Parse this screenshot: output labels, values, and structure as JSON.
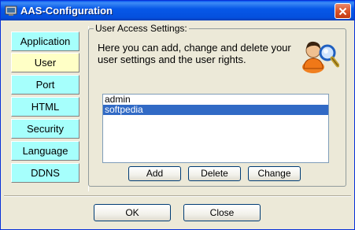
{
  "window": {
    "title": "AAS-Configuration"
  },
  "nav": {
    "items": [
      {
        "label": "Application"
      },
      {
        "label": "User"
      },
      {
        "label": "Port"
      },
      {
        "label": "HTML"
      },
      {
        "label": "Security"
      },
      {
        "label": "Language"
      },
      {
        "label": "DDNS"
      }
    ],
    "active": "User"
  },
  "user_settings": {
    "legend": "User Access Settings:",
    "description": "Here you can add, change and delete your user settings and the user rights.",
    "users": [
      "admin",
      "softpedia"
    ],
    "selected_user": "softpedia",
    "buttons": {
      "add": "Add",
      "delete": "Delete",
      "change": "Change"
    }
  },
  "footer": {
    "ok": "OK",
    "close": "Close"
  },
  "colors": {
    "nav_item": "#a6fffc",
    "nav_active": "#ffffc6",
    "selection": "#316ac5"
  }
}
